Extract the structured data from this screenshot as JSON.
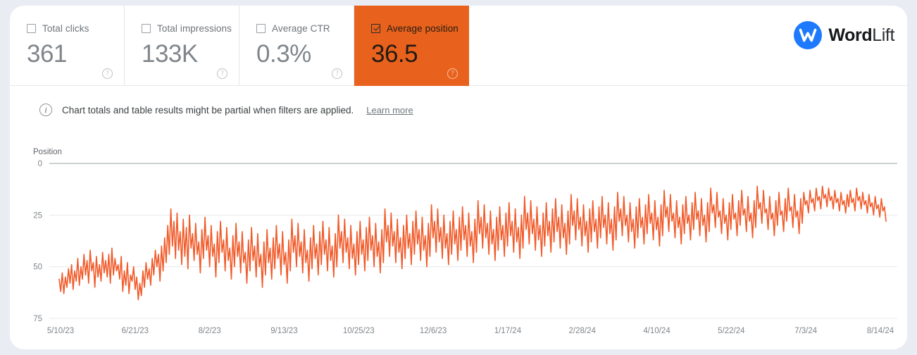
{
  "metrics": [
    {
      "label": "Total clicks",
      "value": "361",
      "checked": false,
      "selected": false,
      "help": "?"
    },
    {
      "label": "Total impressions",
      "value": "133K",
      "checked": false,
      "selected": false,
      "help": "?"
    },
    {
      "label": "Average CTR",
      "value": "0.3%",
      "checked": false,
      "selected": false,
      "help": "?"
    },
    {
      "label": "Average position",
      "value": "36.5",
      "checked": true,
      "selected": true,
      "help": "?"
    }
  ],
  "logo": {
    "mark_letter": "W",
    "name_bold": "Word",
    "name_light": "Lift"
  },
  "notice": {
    "icon": "info-icon",
    "text": "Chart totals and table results might be partial when filters are applied.",
    "link": "Learn more"
  },
  "colors": {
    "accent": "#e8621d",
    "line": "#f15a29",
    "selected_card": "#e8621d",
    "page_background": "#eaecf4",
    "logo_blue": "#1d7afc"
  },
  "chart_data": {
    "type": "line",
    "title": "",
    "xlabel": "",
    "ylabel": "Position",
    "ylim": [
      0,
      75
    ],
    "y_inverted": true,
    "grid": true,
    "legend": false,
    "yticks": [
      0,
      25,
      50,
      75
    ],
    "xticks": [
      "5/10/23",
      "6/21/23",
      "8/2/23",
      "9/13/23",
      "10/25/23",
      "12/6/23",
      "1/17/24",
      "2/28/24",
      "4/10/24",
      "5/22/24",
      "7/3/24",
      "8/14/24"
    ],
    "series": [
      {
        "name": "Average position",
        "color": "#f15a29",
        "values": [
          56,
          62,
          53,
          63,
          55,
          60,
          51,
          58,
          49,
          61,
          52,
          57,
          46,
          59,
          50,
          56,
          44,
          54,
          47,
          58,
          42,
          52,
          48,
          60,
          45,
          55,
          49,
          57,
          43,
          53,
          47,
          55,
          44,
          58,
          41,
          54,
          46,
          52,
          49,
          56,
          45,
          62,
          52,
          59,
          48,
          63,
          54,
          57,
          50,
          61,
          55,
          66,
          58,
          64,
          52,
          60,
          48,
          56,
          51,
          59,
          46,
          54,
          42,
          50,
          44,
          57,
          40,
          52,
          36,
          48,
          30,
          44,
          22,
          40,
          28,
          46,
          24,
          42,
          33,
          49,
          27,
          45,
          31,
          51,
          25,
          41,
          34,
          47,
          29,
          44,
          38,
          53,
          32,
          46,
          26,
          42,
          35,
          50,
          30,
          45,
          39,
          55,
          33,
          48,
          28,
          43,
          37,
          52,
          31,
          47,
          41,
          56,
          35,
          50,
          29,
          45,
          38,
          53,
          33,
          48,
          43,
          58,
          37,
          52,
          31,
          47,
          40,
          55,
          34,
          50,
          44,
          60,
          38,
          54,
          32,
          48,
          41,
          56,
          36,
          51,
          30,
          46,
          39,
          54,
          33,
          49,
          43,
          58,
          37,
          52,
          27,
          43,
          35,
          50,
          29,
          45,
          38,
          53,
          32,
          48,
          42,
          57,
          36,
          51,
          30,
          46,
          39,
          54,
          33,
          49,
          28,
          44,
          37,
          52,
          31,
          47,
          40,
          55,
          34,
          50,
          25,
          41,
          33,
          48,
          27,
          43,
          36,
          51,
          30,
          46,
          39,
          54,
          33,
          49,
          28,
          44,
          37,
          52,
          31,
          47,
          26,
          42,
          35,
          50,
          29,
          45,
          38,
          53,
          32,
          48,
          22,
          38,
          30,
          45,
          24,
          40,
          33,
          48,
          27,
          43,
          36,
          51,
          30,
          46,
          25,
          41,
          34,
          49,
          28,
          44,
          23,
          39,
          32,
          47,
          26,
          42,
          35,
          50,
          29,
          45,
          20,
          36,
          28,
          43,
          22,
          38,
          31,
          46,
          25,
          41,
          34,
          49,
          28,
          44,
          23,
          39,
          32,
          47,
          26,
          42,
          21,
          37,
          30,
          45,
          24,
          40,
          33,
          48,
          27,
          43,
          18,
          34,
          26,
          41,
          20,
          36,
          29,
          44,
          23,
          39,
          32,
          47,
          26,
          42,
          21,
          37,
          30,
          45,
          24,
          40,
          19,
          35,
          28,
          43,
          22,
          38,
          31,
          46,
          25,
          41,
          16,
          32,
          24,
          39,
          18,
          34,
          27,
          42,
          21,
          37,
          30,
          45,
          24,
          40,
          19,
          35,
          28,
          43,
          22,
          38,
          17,
          33,
          26,
          41,
          20,
          36,
          29,
          44,
          23,
          39,
          15,
          30,
          23,
          37,
          17,
          32,
          26,
          40,
          20,
          35,
          28,
          43,
          22,
          38,
          18,
          33,
          27,
          41,
          21,
          36,
          16,
          31,
          25,
          39,
          19,
          34,
          27,
          42,
          21,
          37,
          14,
          28,
          22,
          35,
          16,
          30,
          25,
          38,
          19,
          33,
          27,
          41,
          21,
          36,
          17,
          31,
          26,
          39,
          20,
          34,
          15,
          29,
          24,
          37,
          18,
          32,
          26,
          40,
          20,
          35,
          13,
          26,
          21,
          33,
          15,
          28,
          24,
          36,
          18,
          31,
          26,
          39,
          20,
          34,
          16,
          29,
          25,
          37,
          19,
          32,
          14,
          27,
          23,
          35,
          17,
          30,
          25,
          38,
          19,
          33,
          12,
          24,
          20,
          31,
          14,
          26,
          23,
          34,
          17,
          29,
          25,
          37,
          19,
          32,
          15,
          27,
          24,
          35,
          18,
          30,
          13,
          25,
          22,
          33,
          16,
          28,
          24,
          36,
          18,
          31,
          11,
          22,
          19,
          29,
          13,
          24,
          22,
          32,
          16,
          27,
          24,
          35,
          18,
          30,
          14,
          25,
          23,
          33,
          17,
          28,
          12,
          23,
          21,
          31,
          15,
          26,
          23,
          34,
          17,
          29,
          14,
          20,
          18,
          24,
          13,
          19,
          17,
          23,
          12,
          18,
          16,
          22,
          11,
          17,
          15,
          21,
          12,
          18,
          16,
          22,
          13,
          19,
          17,
          23,
          14,
          20,
          18,
          24,
          15,
          21,
          13,
          19,
          17,
          23,
          12,
          18,
          16,
          22,
          14,
          20,
          18,
          24,
          15,
          21,
          19,
          25,
          16,
          22,
          20,
          26,
          17,
          23,
          21,
          28
        ]
      }
    ]
  }
}
